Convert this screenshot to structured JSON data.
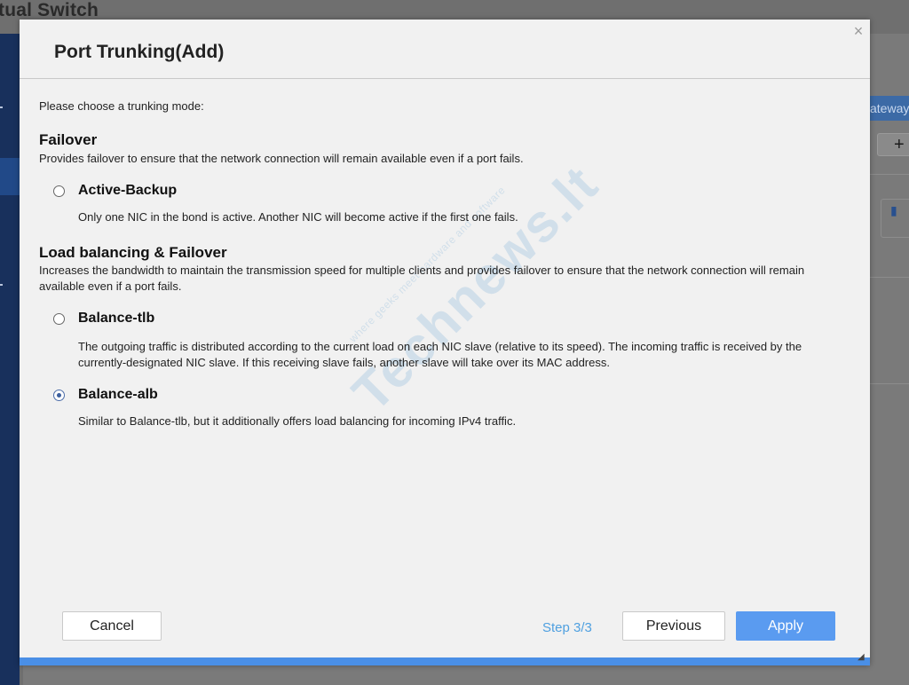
{
  "background": {
    "window_title": "tual Switch",
    "gateway_tab": "ateway",
    "plus_label": "+"
  },
  "dialog": {
    "title": "Port Trunking(Add)",
    "close_label": "×",
    "prompt": "Please choose a trunking mode:",
    "sections": [
      {
        "title": "Failover",
        "description": "Provides failover to ensure that the network connection will remain available even if a port fails.",
        "options": [
          {
            "label": "Active-Backup",
            "description": "Only one NIC in the bond is active. Another NIC will become active if the first one fails.",
            "selected": false
          }
        ]
      },
      {
        "title": "Load balancing & Failover",
        "description": "Increases the bandwidth to maintain the transmission speed for multiple clients and provides failover to ensure that the network connection will remain available even if a port fails.",
        "options": [
          {
            "label": "Balance-tlb",
            "description": "The outgoing traffic is distributed according to the current load on each NIC slave (relative to its speed). The incoming traffic is received by the currently-designated NIC slave. If this receiving slave fails, another slave will take over its MAC address.",
            "selected": false
          },
          {
            "label": "Balance-alb",
            "description": "Similar to Balance-tlb, but it additionally offers load balancing for incoming IPv4 traffic.",
            "selected": true
          }
        ]
      }
    ],
    "watermark": {
      "big": "Technews.lt",
      "small": "where geeks meet hardware and software"
    },
    "footer": {
      "cancel_label": "Cancel",
      "step_text": "Step 3/3",
      "previous_label": "Previous",
      "apply_label": "Apply",
      "progress_fraction": 1.0
    }
  },
  "colors": {
    "accent": "#5a9bf0",
    "step_text": "#4fa0e0",
    "dialog_bg": "#f1f1f1"
  }
}
